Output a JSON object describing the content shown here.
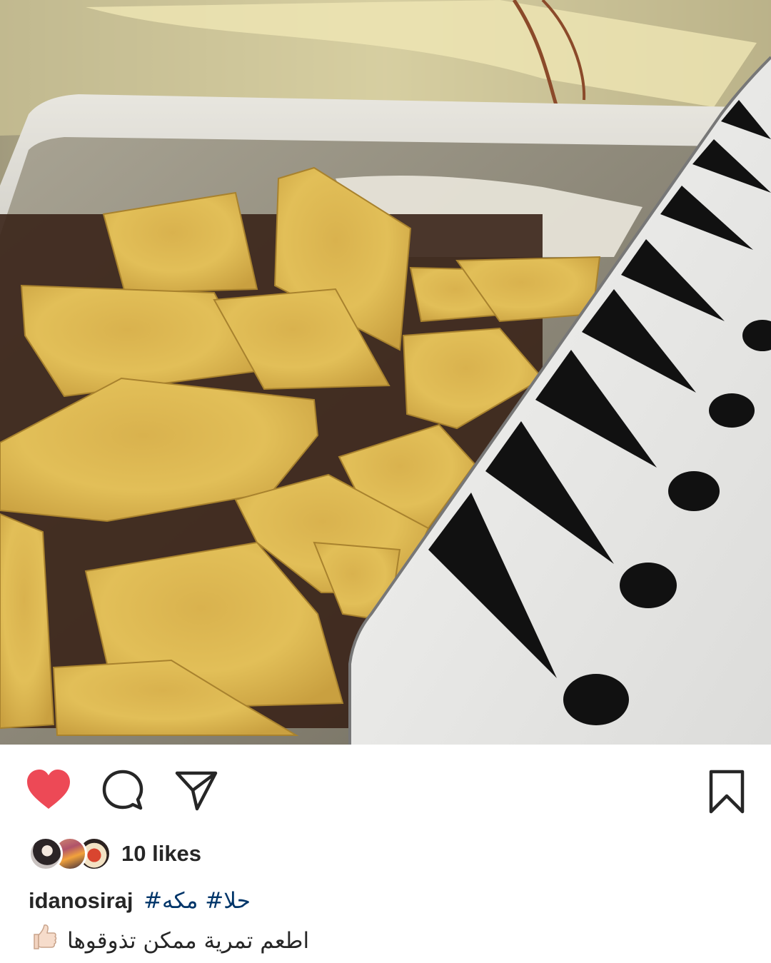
{
  "post": {
    "image_alt": "Date-filled pastry squares in a tin box",
    "likes_text": "10 likes",
    "username": "idanosiraj",
    "hashtags": "#حلا# مكه",
    "caption": "اطعم تمرية ممكن تذوقوها",
    "caption_emoji": "thumbs-up-emoji"
  },
  "actions": {
    "like_icon": "heart-icon",
    "like_state": "liked",
    "comment_icon": "comment-icon",
    "share_icon": "share-icon",
    "save_icon": "bookmark-icon"
  },
  "colors": {
    "like_red": "#ed4956",
    "hashtag_blue": "#003569",
    "text": "#262626"
  }
}
